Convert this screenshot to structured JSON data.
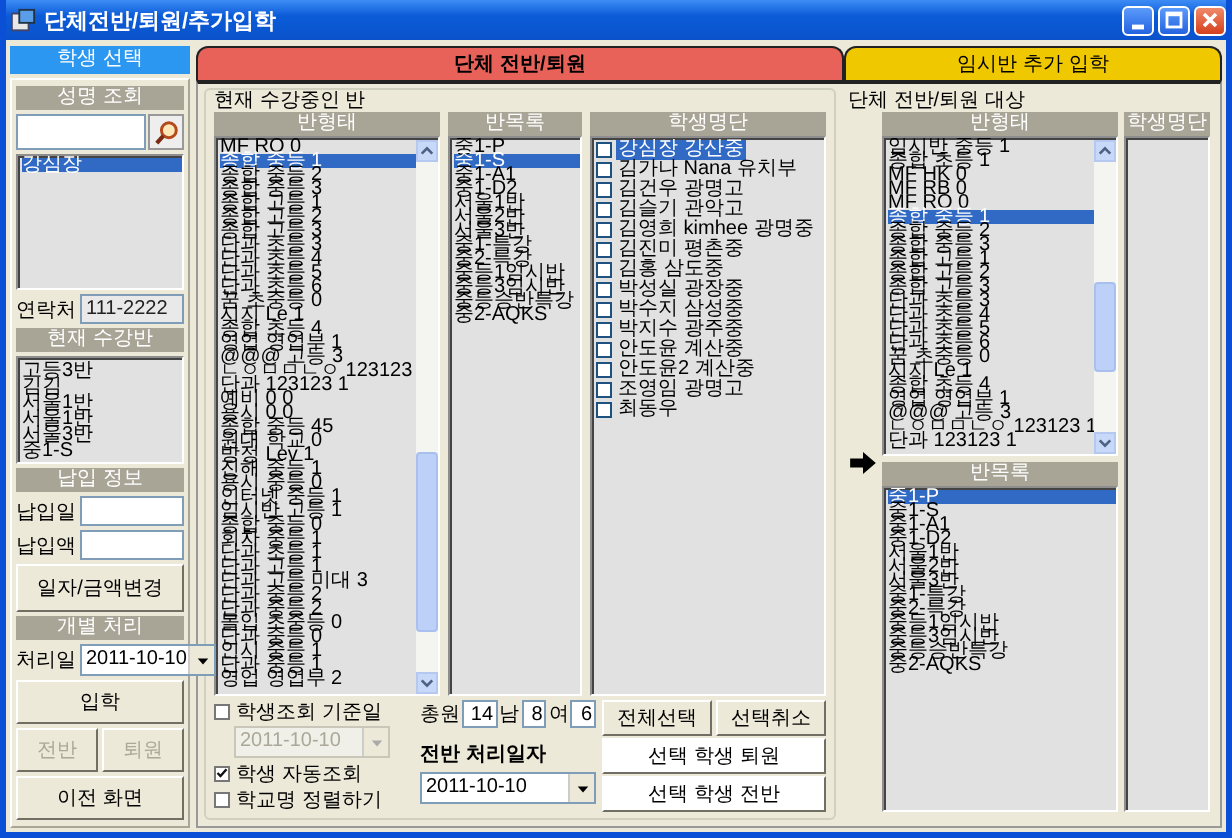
{
  "window": {
    "title": "단체전반/퇴원/추가입학"
  },
  "left_panel": {
    "header": "학생 선택",
    "name_search": {
      "header": "성명 조회",
      "results": [
        {
          "label": "강심장",
          "selected": true
        }
      ]
    },
    "contact": {
      "label": "연락처",
      "value": "111-2222"
    },
    "current_classes": {
      "header": "현재 수강반",
      "items": [
        "고등3반",
        "김김",
        "서울1반",
        "서울1반",
        "서울3반",
        "중1-S"
      ]
    },
    "payment": {
      "header": "납입 정보",
      "fields": [
        "납입일",
        "납입액"
      ],
      "button": "일자/금액변경"
    },
    "individual": {
      "header": "개별 처리",
      "date_label": "처리일",
      "date": "2011-10-10",
      "button_rows": [
        [
          {
            "label": "입학",
            "disabled": false
          }
        ],
        [
          {
            "label": "전반",
            "disabled": true
          },
          {
            "label": "퇴원",
            "disabled": true
          }
        ],
        [
          {
            "label": "이전 화면",
            "disabled": false
          }
        ]
      ]
    }
  },
  "tabs": [
    {
      "label": "단체 전반/퇴원",
      "selected": true
    },
    {
      "label": "임시반 추가 입학",
      "selected": false
    }
  ],
  "current_group": {
    "title": "현재 수강중인 반",
    "class_types": {
      "header": "반형태",
      "items": [
        {
          "label": "MF RO 0",
          "selected": false
        },
        {
          "label": "종합 중등 1",
          "selected": true
        },
        {
          "label": "종합 중등 2",
          "selected": false
        },
        {
          "label": "종합 중등 3",
          "selected": false
        },
        {
          "label": "종합 고등 1",
          "selected": false
        },
        {
          "label": "종합 고등 2",
          "selected": false
        },
        {
          "label": "종합 고등 3",
          "selected": false
        },
        {
          "label": "단과 초등 3",
          "selected": false
        },
        {
          "label": "단과 초등 4",
          "selected": false
        },
        {
          "label": "단과 초등 5",
          "selected": false
        },
        {
          "label": "단과 초등 6",
          "selected": false
        },
        {
          "label": "꿈 초중등 0",
          "selected": false
        },
        {
          "label": "시지 Le 1",
          "selected": false
        },
        {
          "label": "종합 초등 4",
          "selected": false
        },
        {
          "label": "영업 영업부 1",
          "selected": false
        },
        {
          "label": "@@@ 고등 3",
          "selected": false
        },
        {
          "label": "ㄴㅇㅁㅁㄴㅇ 123123",
          "selected": false
        },
        {
          "label": "단과 123123 1",
          "selected": false
        },
        {
          "label": "예비 0 0",
          "selected": false
        },
        {
          "label": "용시 0 0",
          "selected": false
        },
        {
          "label": "종합 중등 45",
          "selected": false
        },
        {
          "label": "원대 학교 0",
          "selected": false
        },
        {
          "label": "방정 Lev 1",
          "selected": false
        },
        {
          "label": "진해 중등 1",
          "selected": false
        },
        {
          "label": "용시 중등 0",
          "selected": false
        },
        {
          "label": "인터넷 중등 1",
          "selected": false
        },
        {
          "label": "임시반 고등 1",
          "selected": false
        },
        {
          "label": "종합 중등 0",
          "selected": false
        },
        {
          "label": "회차 중등 1",
          "selected": false
        },
        {
          "label": "단과 초등 1",
          "selected": false
        },
        {
          "label": "단과 고등 1",
          "selected": false
        },
        {
          "label": "단과 고등 미대 3",
          "selected": false
        },
        {
          "label": "단과 중등 2",
          "selected": false
        },
        {
          "label": "단과 중등 2",
          "selected": false
        },
        {
          "label": "몰입 초중등 0",
          "selected": false
        },
        {
          "label": "단과 중등 0",
          "selected": false
        },
        {
          "label": "인시 중등 1",
          "selected": false
        },
        {
          "label": "단과 중등 1",
          "selected": false
        },
        {
          "label": "영업 영업부 2",
          "selected": false
        }
      ]
    },
    "class_list": {
      "header": "반목록",
      "items": [
        {
          "label": "중1-P",
          "selected": false
        },
        {
          "label": "중1-S",
          "selected": true
        },
        {
          "label": "중1-A1",
          "selected": false
        },
        {
          "label": "중1-D2",
          "selected": false
        },
        {
          "label": "서울1반",
          "selected": false
        },
        {
          "label": "서울2반",
          "selected": false
        },
        {
          "label": "서울3반",
          "selected": false
        },
        {
          "label": "중1-특강",
          "selected": false
        },
        {
          "label": "중2-특강",
          "selected": false
        },
        {
          "label": "중등1임시반",
          "selected": false
        },
        {
          "label": "중등3임시반",
          "selected": false
        },
        {
          "label": "중등승반특강",
          "selected": false
        },
        {
          "label": "중2-AQKS",
          "selected": false
        }
      ]
    },
    "students": {
      "header": "학생명단",
      "items": [
        {
          "label": "강심장 강산중",
          "checked": false,
          "selected": true
        },
        {
          "label": "김가나 Nana 유치부",
          "checked": false,
          "selected": false
        },
        {
          "label": "김건우 광명고",
          "checked": false,
          "selected": false
        },
        {
          "label": "김슬기 관악고",
          "checked": false,
          "selected": false
        },
        {
          "label": "김영희 kimhee 광명중",
          "checked": false,
          "selected": false
        },
        {
          "label": "김진미 평촌중",
          "checked": false,
          "selected": false
        },
        {
          "label": "김홍 삼도중",
          "checked": false,
          "selected": false
        },
        {
          "label": "박성실 광장중",
          "checked": false,
          "selected": false
        },
        {
          "label": "박수지 삼성중",
          "checked": false,
          "selected": false
        },
        {
          "label": "박지수 광주중",
          "checked": false,
          "selected": false
        },
        {
          "label": "안도윤 계산중",
          "checked": false,
          "selected": false
        },
        {
          "label": "안도윤2 계산중",
          "checked": false,
          "selected": false
        },
        {
          "label": "조영임 광명고",
          "checked": false,
          "selected": false
        },
        {
          "label": "최동우",
          "checked": false,
          "selected": false
        }
      ]
    },
    "lookup_date": {
      "label": "학생조회 기준일",
      "checked": false,
      "date": "2011-10-10",
      "disabled": true
    },
    "options": [
      {
        "label": "학생 자동조회",
        "checked": true
      },
      {
        "label": "학교명 정렬하기",
        "checked": false
      }
    ],
    "totals": [
      {
        "label": "총원",
        "value": "14"
      },
      {
        "label": "남",
        "value": "8"
      },
      {
        "label": "여",
        "value": "6"
      }
    ],
    "transfer_date": {
      "label": "전반 처리일자",
      "value": "2011-10-10"
    },
    "selection_buttons": [
      "전체선택",
      "선택취소"
    ],
    "action_buttons": [
      "선택 학생 퇴원",
      "선택 학생 전반"
    ]
  },
  "target_group": {
    "title": "단체 전반/퇴원 대상",
    "class_types": {
      "header": "반형태",
      "items": [
        {
          "label": "임시반 중등 1",
          "selected": false
        },
        {
          "label": "종합 초등 1",
          "selected": false
        },
        {
          "label": "MF HK 0",
          "selected": false
        },
        {
          "label": "MF RB 0",
          "selected": false
        },
        {
          "label": "MF RO 0",
          "selected": false
        },
        {
          "label": "종합 중등 1",
          "selected": true
        },
        {
          "label": "종합 중등 2",
          "selected": false
        },
        {
          "label": "종합 중등 3",
          "selected": false
        },
        {
          "label": "종합 고등 1",
          "selected": false
        },
        {
          "label": "종합 고등 2",
          "selected": false
        },
        {
          "label": "종합 고등 3",
          "selected": false
        },
        {
          "label": "단과 초등 3",
          "selected": false
        },
        {
          "label": "단과 초등 4",
          "selected": false
        },
        {
          "label": "단과 초등 5",
          "selected": false
        },
        {
          "label": "단과 초등 6",
          "selected": false
        },
        {
          "label": "꿈 초중등 0",
          "selected": false
        },
        {
          "label": "시지 Le 1",
          "selected": false
        },
        {
          "label": "종합 초등 4",
          "selected": false
        },
        {
          "label": "영업 영업부 1",
          "selected": false
        },
        {
          "label": "@@@ 고등 3",
          "selected": false
        },
        {
          "label": "ㄴㅇㅁㅁㄴㅇ 123123 1",
          "selected": false
        },
        {
          "label": "단과 123123 1",
          "selected": false
        }
      ]
    },
    "class_list": {
      "header": "반목록",
      "items": [
        {
          "label": "중1-P",
          "selected": true
        },
        {
          "label": "중1-S",
          "selected": false
        },
        {
          "label": "중1-A1",
          "selected": false
        },
        {
          "label": "중1-D2",
          "selected": false
        },
        {
          "label": "서울1반",
          "selected": false
        },
        {
          "label": "서울2반",
          "selected": false
        },
        {
          "label": "서울3반",
          "selected": false
        },
        {
          "label": "중1-특강",
          "selected": false
        },
        {
          "label": "중2-특강",
          "selected": false
        },
        {
          "label": "중등1임시반",
          "selected": false
        },
        {
          "label": "중등3임시반",
          "selected": false
        },
        {
          "label": "중등승반특강",
          "selected": false
        },
        {
          "label": "중2-AQKS",
          "selected": false
        }
      ]
    },
    "students": {
      "header": "학생명단"
    }
  }
}
